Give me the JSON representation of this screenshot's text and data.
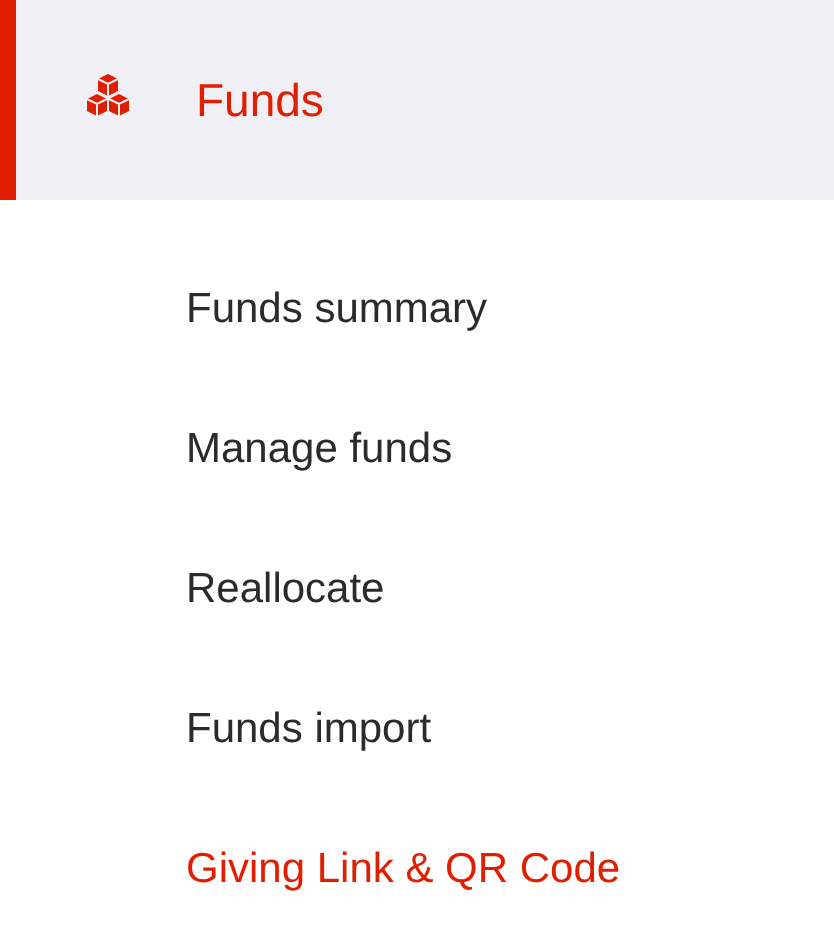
{
  "section": {
    "label": "Funds",
    "selected": true
  },
  "items": [
    {
      "label": "Funds summary",
      "selected": false
    },
    {
      "label": "Manage funds",
      "selected": false
    },
    {
      "label": "Reallocate",
      "selected": false
    },
    {
      "label": "Funds import",
      "selected": false
    },
    {
      "label": "Giving Link & QR Code",
      "selected": true
    }
  ]
}
